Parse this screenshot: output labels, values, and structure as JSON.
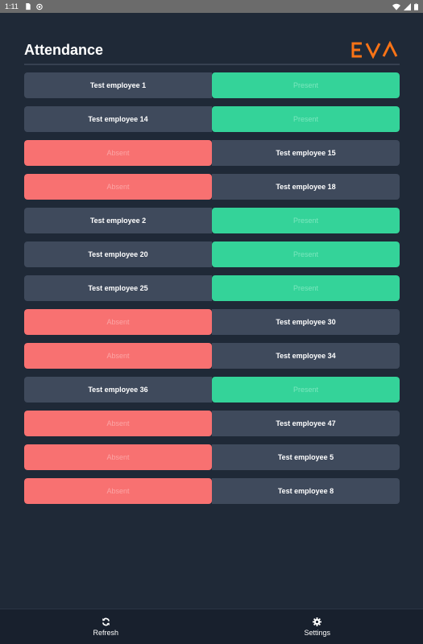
{
  "status_bar": {
    "time": "1:11"
  },
  "header": {
    "title": "Attendance",
    "logo_text": "EVA",
    "logo_color": "#f97316"
  },
  "colors": {
    "background": "#1f2937",
    "name_cell": "#3f4a5c",
    "present": "#34d399",
    "absent": "#f87171"
  },
  "attendance": [
    {
      "name": "Test employee 1",
      "status": "Present",
      "side": "name-left"
    },
    {
      "name": "Test employee 14",
      "status": "Present",
      "side": "name-left"
    },
    {
      "name": "Test employee 15",
      "status": "Absent",
      "side": "status-left"
    },
    {
      "name": "Test employee 18",
      "status": "Absent",
      "side": "status-left"
    },
    {
      "name": "Test employee 2",
      "status": "Present",
      "side": "name-left"
    },
    {
      "name": "Test employee 20",
      "status": "Present",
      "side": "name-left"
    },
    {
      "name": "Test employee 25",
      "status": "Present",
      "side": "name-left"
    },
    {
      "name": "Test employee 30",
      "status": "Absent",
      "side": "status-left"
    },
    {
      "name": "Test employee 34",
      "status": "Absent",
      "side": "status-left"
    },
    {
      "name": "Test employee 36",
      "status": "Present",
      "side": "name-left"
    },
    {
      "name": "Test employee 47",
      "status": "Absent",
      "side": "status-left"
    },
    {
      "name": "Test employee 5",
      "status": "Absent",
      "side": "status-left"
    },
    {
      "name": "Test employee 8",
      "status": "Absent",
      "side": "status-left"
    }
  ],
  "bottom_nav": [
    {
      "label": "Refresh",
      "icon": "refresh-icon"
    },
    {
      "label": "Settings",
      "icon": "gear-icon"
    }
  ]
}
